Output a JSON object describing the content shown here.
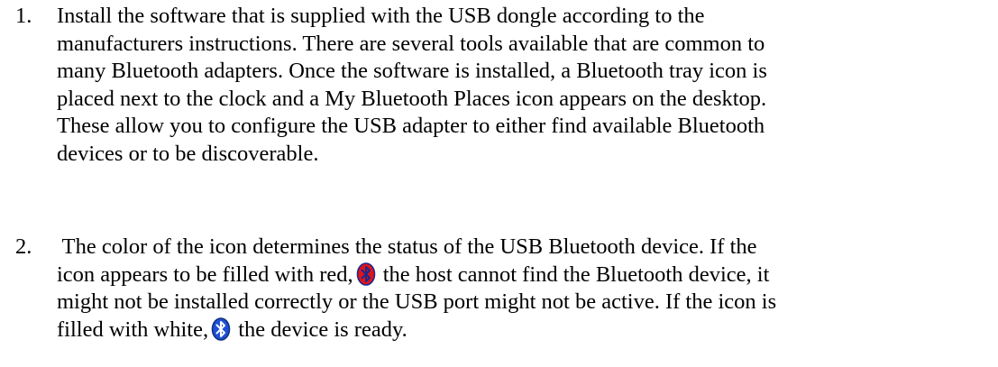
{
  "items": [
    {
      "number": "1.",
      "lines": [
        "Install the software that is supplied with the USB dongle according to the",
        "manufacturers instructions. There are several tools available that are common to",
        "many Bluetooth adapters. Once the software is installed, a Bluetooth tray icon is",
        "placed next to the clock and a My Bluetooth Places icon appears on the desktop.",
        "These allow you to configure the USB adapter to either find available Bluetooth",
        "devices or to be discoverable."
      ]
    },
    {
      "number": "2.",
      "line1": " The color of the icon determines the status of the USB Bluetooth device. If the",
      "line2_before": "icon appears to be filled with red,",
      "line2_after": " the host cannot find the Bluetooth device, it",
      "line3": "might not be installed correctly or the USB port might not be active. If the icon is",
      "line4_before": "filled with white,",
      "line4_after": " the device is ready."
    }
  ],
  "icons": {
    "red_icon": {
      "name": "bluetooth-red-icon",
      "fill": "#e0141b",
      "outline": "#1a2a8c",
      "glyph": "#1a2a8c"
    },
    "white_icon": {
      "name": "bluetooth-white-icon",
      "fill": "#1f4fd6",
      "outline": "#12307f",
      "glyph": "#ffffff"
    }
  }
}
